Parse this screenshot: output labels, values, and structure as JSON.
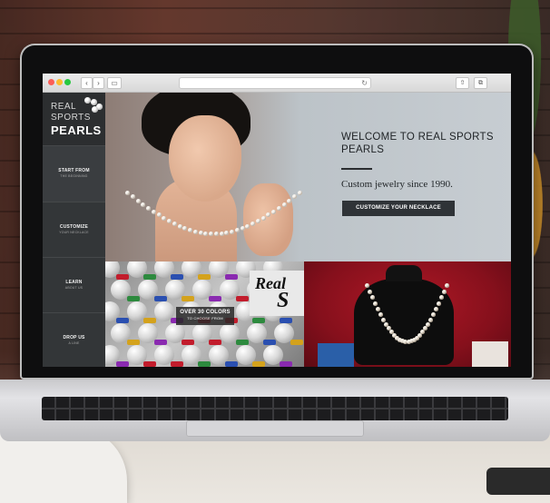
{
  "browser": {
    "address": "",
    "back_label": "‹",
    "forward_label": "›",
    "reload_label": "↻"
  },
  "site": {
    "logo": {
      "line1": "REAL",
      "line2": "SPORTS",
      "line3": "PEARLS"
    },
    "nav": [
      {
        "title": "START FROM",
        "subtitle": "THE BEGINNING",
        "active": true
      },
      {
        "title": "CUSTOMIZE",
        "subtitle": "YOUR NECKLACE",
        "active": false
      },
      {
        "title": "LEARN",
        "subtitle": "ABOUT US",
        "active": false
      },
      {
        "title": "DROP US",
        "subtitle": "A LINE",
        "active": false
      }
    ],
    "hero": {
      "title": "WELCOME TO REAL SPORTS PEARLS",
      "subtitle": "Custom jewelry since 1990.",
      "button": "CUSTOMIZE YOUR NECKLACE"
    },
    "tiles": {
      "colors_title": "OVER 30 COLORS",
      "colors_sub": "TO CHOOSE FROM",
      "brand_mark_a": "Real",
      "brand_mark_b": "S"
    }
  },
  "colors": {
    "sidebar": "#333638",
    "button": "#2f3337",
    "accent_red": "#b01826"
  }
}
